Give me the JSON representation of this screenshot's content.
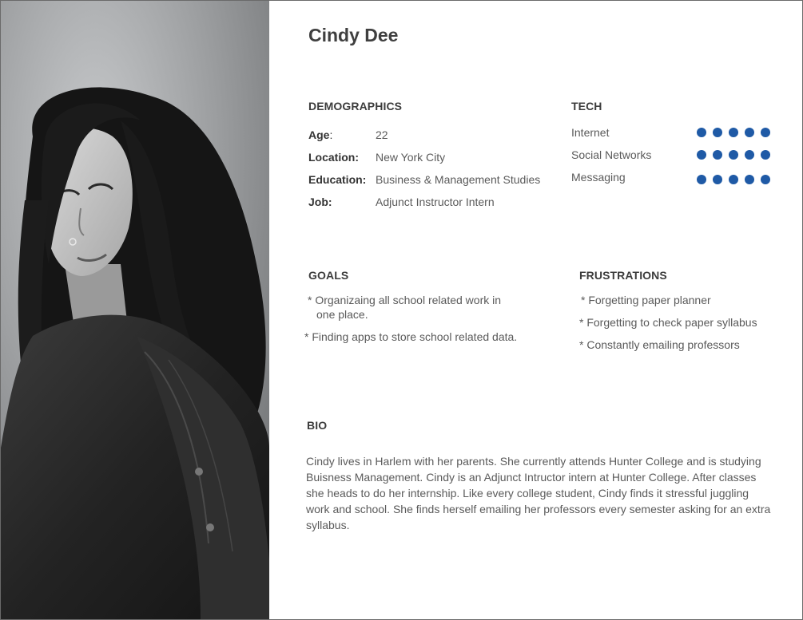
{
  "persona": {
    "name": "Cindy Dee",
    "photo_icon": "portrait-photo"
  },
  "demographics": {
    "title": "DEMOGRAPHICS",
    "rows": [
      {
        "label": "Age",
        "colon": ":",
        "value": "22"
      },
      {
        "label": "Location:",
        "colon": "",
        "value": "New York City"
      },
      {
        "label": "Education:",
        "colon": "",
        "value": "Business & Management Studies"
      },
      {
        "label": "Job:",
        "colon": "",
        "value": "Adjunct Instructor Intern"
      }
    ]
  },
  "tech": {
    "title": "TECH",
    "max_rating": 5,
    "accent_color": "#1f5aa6",
    "items": [
      {
        "label": "Internet",
        "rating": 5
      },
      {
        "label": "Social Networks",
        "rating": 5
      },
      {
        "label": "Messaging",
        "rating": 5
      }
    ]
  },
  "goals": {
    "title": "GOALS",
    "items": [
      {
        "line1": "* Organizaing all school related work in",
        "line2": "one place."
      },
      {
        "line1": "* Finding apps to store school related data.",
        "line2": ""
      }
    ]
  },
  "frustrations": {
    "title": "FRUSTRATIONS",
    "items": [
      "* Forgetting paper planner",
      "* Forgetting to check paper syllabus",
      "* Constantly emailing professors"
    ]
  },
  "bio": {
    "title": "BIO",
    "text": "Cindy lives in Harlem with her parents. She currently attends Hunter College and is studying Buisness Management. Cindy is an Adjunct Intructor intern at Hunter College. After classes she heads to do her internship. Like every college student, Cindy finds it stressful juggling work and school. She finds herself emailing her professors every semester asking for an extra syllabus."
  }
}
